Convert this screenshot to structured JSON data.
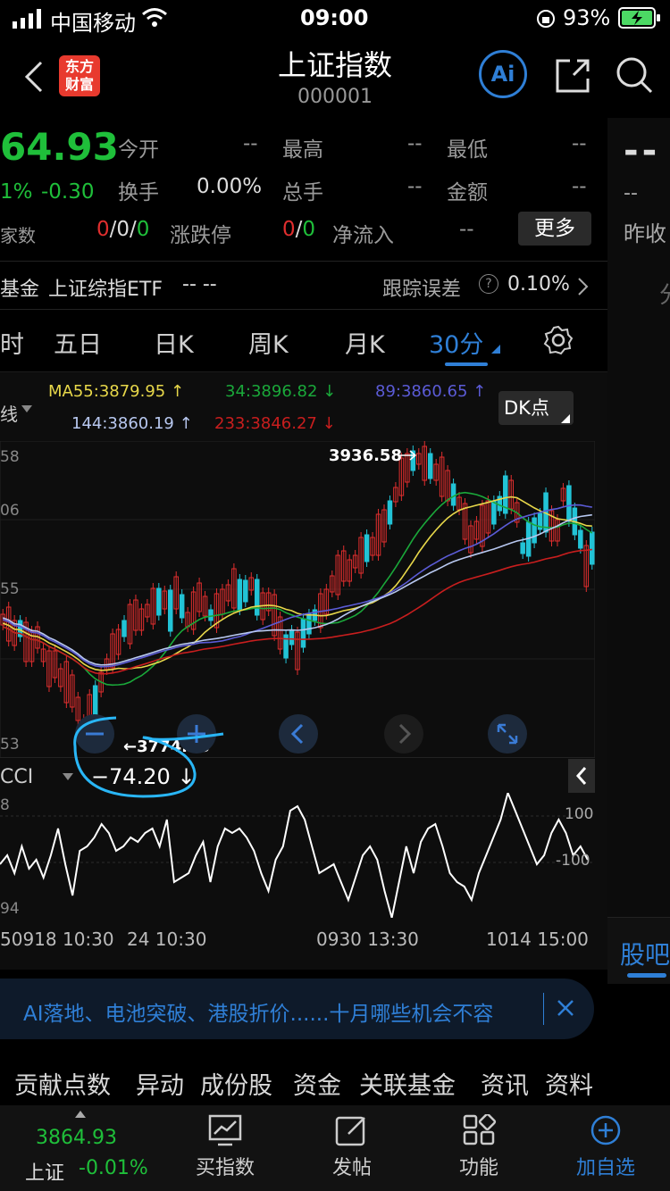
{
  "status": {
    "carrier": "中国移动",
    "time": "09:00",
    "battery": "93%"
  },
  "header": {
    "title": "上证指数",
    "code": "000001",
    "logo_line1": "东方",
    "logo_line2": "财富",
    "ai_label": "Ai"
  },
  "quote": {
    "price": "64.93",
    "pct": "1%",
    "change": "-0.30",
    "open_label": "今开",
    "open_val": "--",
    "high_label": "最高",
    "high_val": "--",
    "low_label": "最低",
    "low_val": "--",
    "turnover_label": "换手",
    "turnover_val": "0.00%",
    "volume_label": "总手",
    "volume_val": "--",
    "amount_label": "金额",
    "amount_val": "--",
    "count_label": "家数",
    "count_red": "0",
    "count_rest": "/0/",
    "count_green": "0",
    "limit_label": "涨跌停",
    "limit_red": "0",
    "limit_sep": "/",
    "limit_green": "0",
    "inflow_label": "净流入",
    "inflow_val": "--",
    "more_label": "更多",
    "right_dash1": "--",
    "right_dash2": "--",
    "right_prevclose": "昨收"
  },
  "fund": {
    "label": "基金",
    "name": "上证综指ETF",
    "dash": "-- --",
    "track_label": "跟踪误差",
    "help": "?",
    "track_val": "0.10%"
  },
  "tabs": [
    {
      "label": "时"
    },
    {
      "label": "五日"
    },
    {
      "label": "日K"
    },
    {
      "label": "周K"
    },
    {
      "label": "月K"
    },
    {
      "label": "30分"
    }
  ],
  "ma": {
    "ma55": "MA55:3879.95 ↑",
    "ma34": "34:3896.82 ↓",
    "ma89": "89:3860.65 ↑",
    "ma144": "144:3860.19 ↑",
    "ma233": "233:3846.27 ↓",
    "line_select": "线",
    "dk": "DK点"
  },
  "chart_labels": {
    "y_top": "58",
    "y_2": "06",
    "y_3": "55",
    "y_bottom": "53",
    "high_annot": "3936.58",
    "low_annot": "←3774.53",
    "ind_name": "CCI",
    "ind_val": "−74.20 ↓",
    "ind_top": "8",
    "ind_bottom": "94",
    "ind_100": "100",
    "ind_m100": "-100",
    "x1": "50918 10:30",
    "x2": "24 10:30",
    "x3": "0930 13:30",
    "x4": "1014 15:00"
  },
  "right_panel": {
    "char": "分",
    "guba": "股吧"
  },
  "banner": {
    "text": "AI落地、电池突破、港股折价......十月哪些机会不容"
  },
  "bottom_tabs": [
    "贡献点数",
    "异动",
    "成份股",
    "资金",
    "关联基金",
    "资讯",
    "资料"
  ],
  "bottombar": {
    "price": "3864.93",
    "name": "上证",
    "pct": "-0.01%",
    "buy": "买指数",
    "post": "发帖",
    "func": "功能",
    "add": "加自选"
  },
  "colors": {
    "up": "#e02e2e",
    "down": "#1fbf3a",
    "accent": "#2f7fd6",
    "ma55": "#e8d84a",
    "ma34": "#1aa83a",
    "ma89": "#5b5bd6",
    "ma144": "#b8c8f0",
    "ma233": "#c81e1e"
  }
}
